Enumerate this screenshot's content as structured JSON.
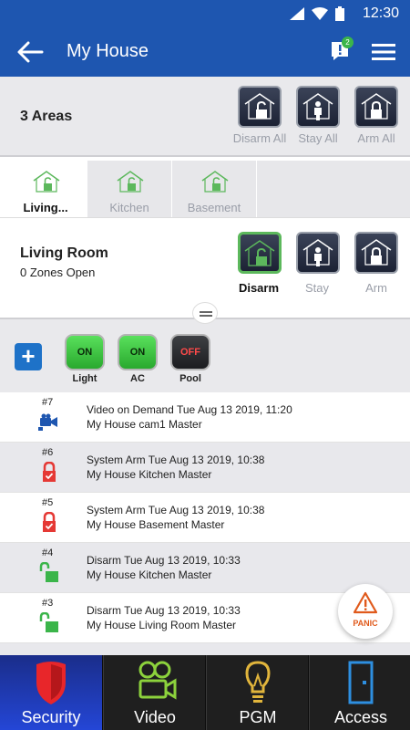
{
  "statusbar": {
    "time": "12:30"
  },
  "appbar": {
    "title": "My House",
    "notif_count": "2"
  },
  "areas": {
    "count_label": "3 Areas",
    "buttons": [
      {
        "label": "Disarm All",
        "icon": "disarm-house-icon"
      },
      {
        "label": "Stay All",
        "icon": "stay-house-icon"
      },
      {
        "label": "Arm All",
        "icon": "arm-house-icon"
      }
    ]
  },
  "tabs": [
    {
      "label": "Living...",
      "active": true
    },
    {
      "label": "Kitchen",
      "active": false
    },
    {
      "label": "Basement",
      "active": false
    }
  ],
  "room": {
    "name": "Living Room",
    "zones": "0 Zones Open",
    "buttons": [
      {
        "label": "Disarm",
        "active": true
      },
      {
        "label": "Stay",
        "active": false
      },
      {
        "label": "Arm",
        "active": false
      }
    ]
  },
  "pgm": {
    "outputs": [
      {
        "state": "ON",
        "label": "Light"
      },
      {
        "state": "ON",
        "label": "AC"
      },
      {
        "state": "OFF",
        "label": "Pool"
      }
    ]
  },
  "events": [
    {
      "num": "#7",
      "line1": "Video on Demand Tue Aug 13 2019, 11:20",
      "line2": "My House cam1 Master",
      "icon": "video-camera-icon"
    },
    {
      "num": "#6",
      "line1": "System Arm Tue Aug 13 2019, 10:38",
      "line2": "My House Kitchen Master",
      "icon": "locked-red-icon"
    },
    {
      "num": "#5",
      "line1": "System Arm Tue Aug 13 2019, 10:38",
      "line2": "My House Basement Master",
      "icon": "locked-red-icon"
    },
    {
      "num": "#4",
      "line1": "Disarm Tue Aug 13 2019, 10:33",
      "line2": "My House Kitchen Master",
      "icon": "unlocked-green-icon"
    },
    {
      "num": "#3",
      "line1": "Disarm Tue Aug 13 2019, 10:33",
      "line2": "My House Living Room Master",
      "icon": "unlocked-green-icon"
    }
  ],
  "panic": {
    "label": "PANIC"
  },
  "bottomnav": [
    {
      "label": "Security",
      "active": true
    },
    {
      "label": "Video",
      "active": false
    },
    {
      "label": "PGM",
      "active": false
    },
    {
      "label": "Access",
      "active": false
    }
  ],
  "colors": {
    "primary": "#1e56b0",
    "green": "#3bb54a",
    "red": "#e53935",
    "panic": "#e05a1c"
  }
}
